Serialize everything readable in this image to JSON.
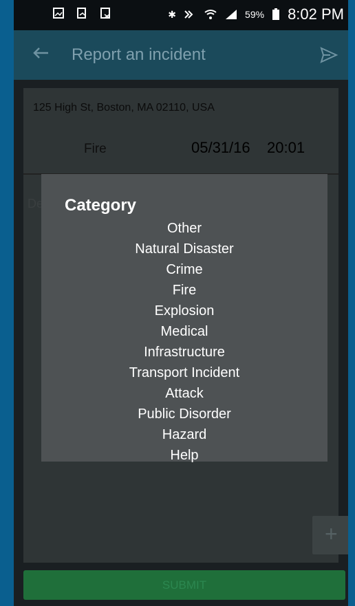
{
  "statusbar": {
    "icons_left": [
      "gallery-icon",
      "document-icon",
      "sim-off-icon"
    ],
    "bluetooth": "✱",
    "battery_percent": "59%",
    "time": "8:02 PM"
  },
  "appbar": {
    "title": "Report an incident",
    "back_icon": "arrow-left-icon",
    "send_icon": "send-icon"
  },
  "form": {
    "address": "125 High St, Boston, MA 02110, USA",
    "category_value": "Fire",
    "date_value": "05/31/16",
    "time_value": "20:01",
    "description_hint": "De"
  },
  "submit_label": "SUBMIT",
  "dialog": {
    "title": "Category",
    "items": [
      "Other",
      "Natural Disaster",
      "Crime",
      "Fire",
      "Explosion",
      "Medical",
      "Infrastructure",
      "Transport Incident",
      "Attack",
      "Public Disorder",
      "Hazard",
      "Help"
    ]
  }
}
